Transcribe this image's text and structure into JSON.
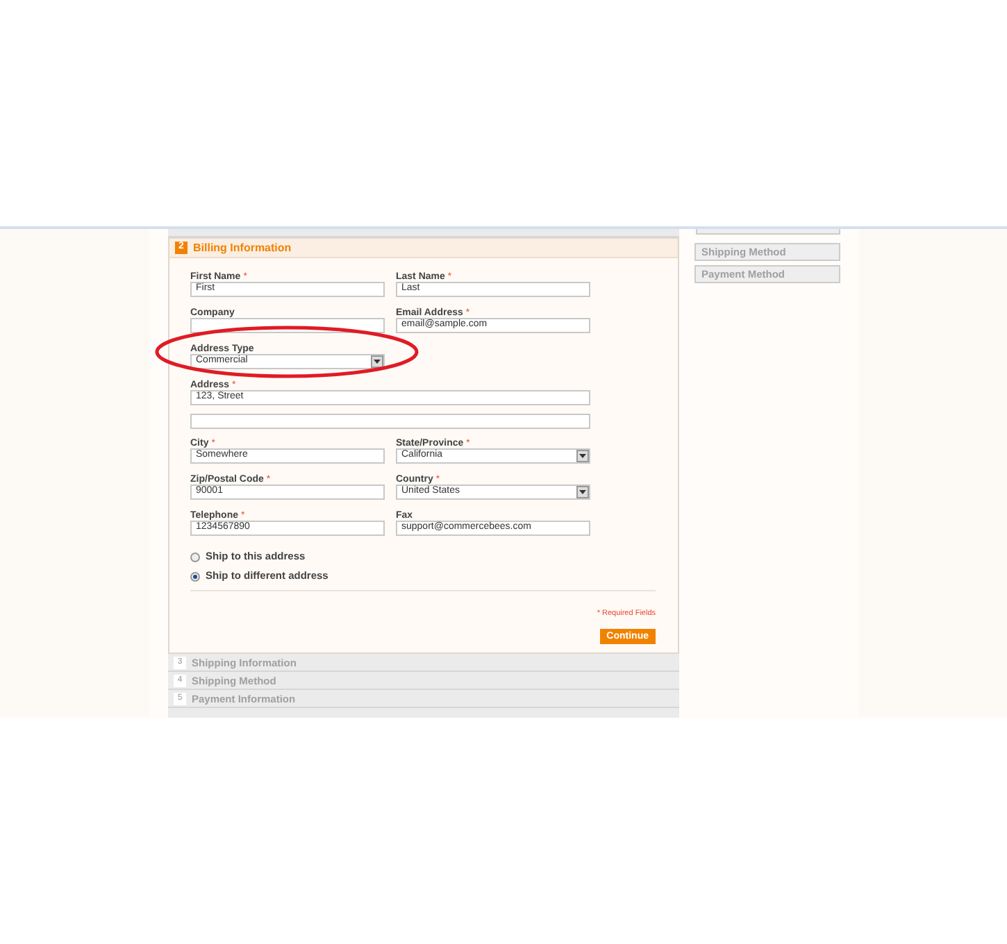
{
  "steps_above": [
    {
      "expanded": false
    }
  ],
  "billing": {
    "number": "2",
    "title": "Billing Information",
    "expanded": true,
    "rows": [
      [
        {
          "label": "First Name",
          "required_mark": "*",
          "kind": "text",
          "value": "First"
        },
        {
          "label": "Last Name",
          "required_mark": "*",
          "kind": "text",
          "value": "Last"
        }
      ],
      [
        {
          "label": "Company",
          "kind": "text"
        },
        {
          "label": "Email Address",
          "required_mark": "*",
          "kind": "text",
          "value": "email@sample.com"
        }
      ],
      [
        {
          "label": "Address Type",
          "kind": "select",
          "value": "Commercial"
        }
      ],
      [
        {
          "label": "Address",
          "required_mark": "*",
          "kind": "wide",
          "value": "123, Street"
        }
      ],
      [
        {
          "kind": "wide"
        }
      ],
      [
        {
          "label": "City",
          "required_mark": "*",
          "kind": "text",
          "value": "Somewhere"
        },
        {
          "label": "State/Province",
          "required_mark": "*",
          "kind": "select",
          "value": "California"
        }
      ],
      [
        {
          "label": "Zip/Postal Code",
          "required_mark": "*",
          "kind": "text",
          "value": "90001"
        },
        {
          "label": "Country",
          "required_mark": "*",
          "kind": "select",
          "value": "United States"
        }
      ],
      [
        {
          "label": "Telephone",
          "required_mark": "*",
          "kind": "text",
          "value": "1234567890"
        },
        {
          "label": "Fax",
          "kind": "text",
          "value": "support@commercebees.com"
        }
      ]
    ],
    "radios": [
      {
        "label": "Ship to this address",
        "selected": false
      },
      {
        "label": "Ship to different address",
        "selected": true
      }
    ],
    "required_note": "* Required Fields",
    "button": "Continue"
  },
  "steps_below": [
    {
      "number": "3",
      "title": "Shipping Information",
      "expanded": false
    },
    {
      "number": "4",
      "title": "Shipping Method",
      "expanded": false
    },
    {
      "number": "5",
      "title": "Payment Information",
      "expanded": false
    }
  ],
  "sidebar": [
    "Shipping Method",
    "Payment Method"
  ]
}
